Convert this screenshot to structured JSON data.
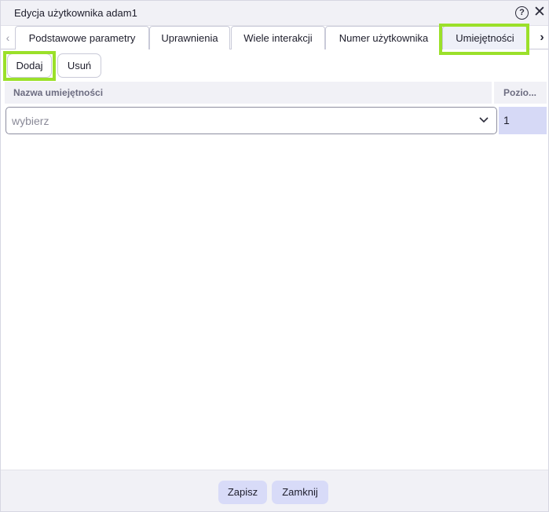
{
  "dialog": {
    "title": "Edycja użytkownika adam1",
    "help_symbol": "?",
    "close_symbol": "✕"
  },
  "tabs": {
    "prev_symbol": "‹",
    "next_symbol": "›",
    "items": [
      {
        "label": "Podstawowe parametry",
        "active": false
      },
      {
        "label": "Uprawnienia",
        "active": false
      },
      {
        "label": "Wiele interakcji",
        "active": false
      },
      {
        "label": "Numer użytkownika",
        "active": false
      },
      {
        "label": "Umiejętności",
        "active": true
      }
    ]
  },
  "toolbar": {
    "add_label": "Dodaj",
    "remove_label": "Usuń"
  },
  "grid": {
    "columns": [
      "Nazwa umiejętności",
      "Pozio..."
    ],
    "rows": [
      {
        "skill_placeholder": "wybierz",
        "level": "1"
      }
    ]
  },
  "footer": {
    "save_label": "Zapisz",
    "close_label": "Zamknij"
  },
  "colors": {
    "highlight": "#9be02a",
    "accent_button": "#d8dbf8",
    "selected_cell": "#d6d9f6"
  },
  "icons": {
    "help": "help-circle-icon",
    "close": "close-icon",
    "prev": "chevron-left-icon",
    "next": "chevron-right-icon",
    "dropdown": "chevron-down-icon"
  }
}
